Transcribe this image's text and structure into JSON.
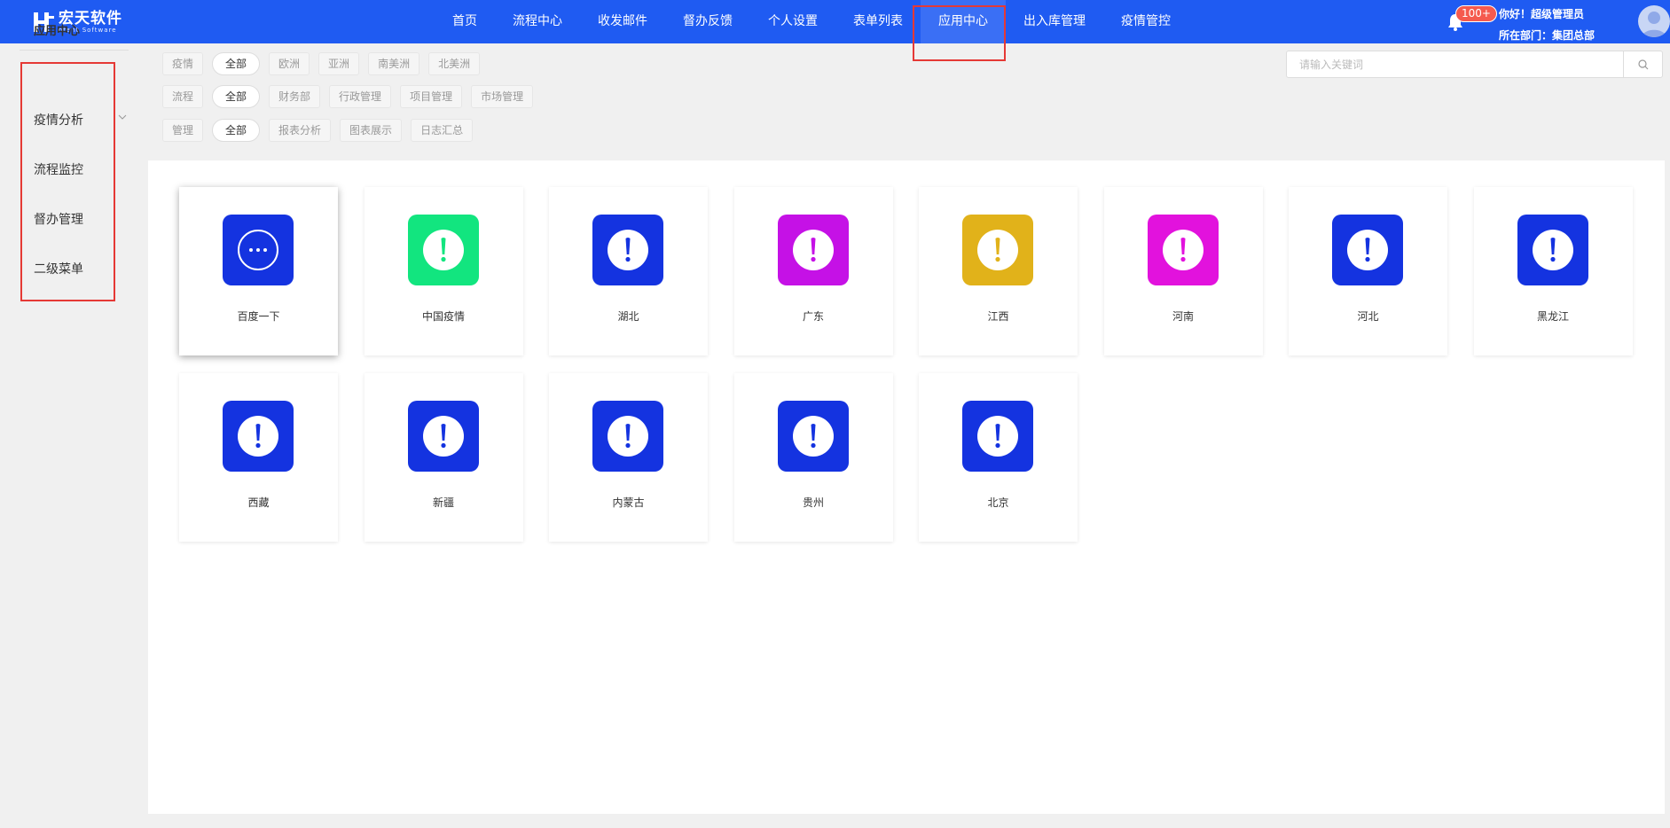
{
  "logo": {
    "cn": "宏天软件",
    "en": "otent Software"
  },
  "nav": [
    {
      "label": "首页"
    },
    {
      "label": "流程中心"
    },
    {
      "label": "收发邮件"
    },
    {
      "label": "督办反馈"
    },
    {
      "label": "个人设置"
    },
    {
      "label": "表单列表"
    },
    {
      "label": "应用中心",
      "active": true
    },
    {
      "label": "出入库管理"
    },
    {
      "label": "疫情管控"
    }
  ],
  "user": {
    "badge": "100+",
    "greeting": "你好！超级管理员",
    "dept": "所在部门：集团总部"
  },
  "sidebar": {
    "title": "应用中心",
    "items": [
      "疫情分析",
      "流程监控",
      "督办管理",
      "二级菜单"
    ]
  },
  "filters": [
    {
      "label": "疫情",
      "all": "全部",
      "options": [
        "欧洲",
        "亚洲",
        "南美洲",
        "北美洲"
      ]
    },
    {
      "label": "流程",
      "all": "全部",
      "options": [
        "财务部",
        "行政管理",
        "项目管理",
        "市场管理"
      ]
    },
    {
      "label": "管理",
      "all": "全部",
      "options": [
        "报表分析",
        "图表展示",
        "日志汇总"
      ]
    }
  ],
  "search": {
    "placeholder": "请输入关键词",
    "value": ""
  },
  "apps": [
    {
      "name": "百度一下",
      "color": "#1433e0",
      "icon": "more-icon"
    },
    {
      "name": "中国疫情",
      "color": "#12e57f",
      "icon": "alert-icon"
    },
    {
      "name": "湖北",
      "color": "#1433e0",
      "icon": "alert-icon"
    },
    {
      "name": "广东",
      "color": "#c511e6",
      "icon": "alert-icon"
    },
    {
      "name": "江西",
      "color": "#e1b21a",
      "icon": "alert-icon"
    },
    {
      "name": "河南",
      "color": "#e212dd",
      "icon": "alert-icon"
    },
    {
      "name": "河北",
      "color": "#1433e0",
      "icon": "alert-icon"
    },
    {
      "name": "黑龙江",
      "color": "#1433e0",
      "icon": "alert-icon"
    },
    {
      "name": "西藏",
      "color": "#1433e0",
      "icon": "alert-icon"
    },
    {
      "name": "新疆",
      "color": "#1433e0",
      "icon": "alert-icon"
    },
    {
      "name": "内蒙古",
      "color": "#1433e0",
      "icon": "alert-icon"
    },
    {
      "name": "贵州",
      "color": "#1433e0",
      "icon": "alert-icon"
    },
    {
      "name": "北京",
      "color": "#1433e0",
      "icon": "alert-icon"
    }
  ]
}
